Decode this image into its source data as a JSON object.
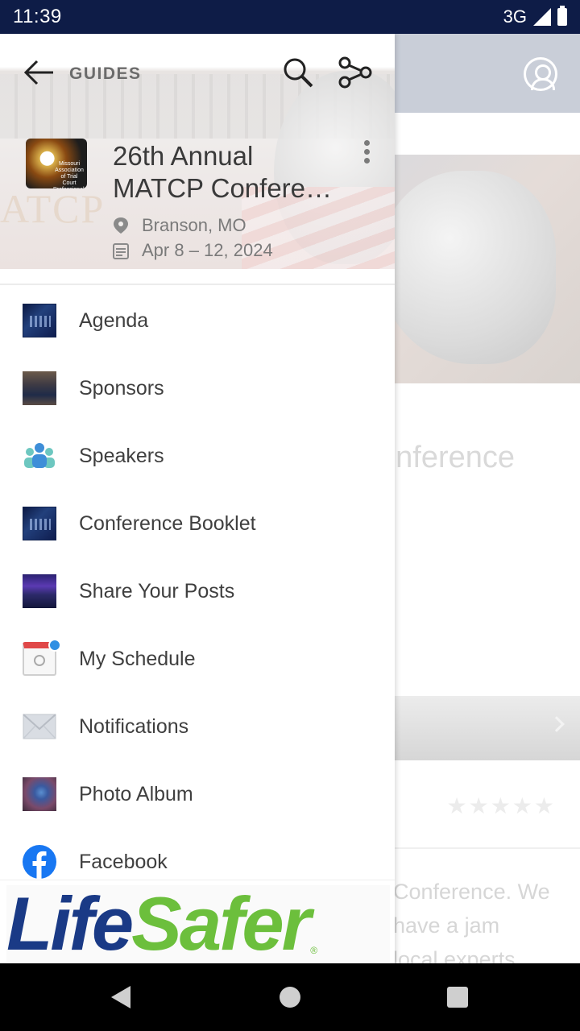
{
  "status_bar": {
    "time": "11:39",
    "network": "3G"
  },
  "background": {
    "title_fragment": "onference",
    "stars": "★★★★★",
    "text_lines": [
      "Conference. We",
      "have a jam",
      "local experts"
    ]
  },
  "drawer": {
    "toolbar": {
      "label": "GUIDES"
    },
    "event": {
      "title_line1": "26th Annual",
      "title_line2": "MATCP Confere…",
      "location": "Branson, MO",
      "dates": "Apr 8 – 12, 2024",
      "logo_text": "Missouri Association of Trial Court Professionals",
      "seal_text": "ATCP"
    },
    "menu_items": [
      {
        "label": "Agenda",
        "icon": "agenda-thumbnail"
      },
      {
        "label": "Sponsors",
        "icon": "sponsors-thumbnail"
      },
      {
        "label": "Speakers",
        "icon": "people-icon"
      },
      {
        "label": "Conference Booklet",
        "icon": "booklet-thumbnail"
      },
      {
        "label": "Share Your Posts",
        "icon": "posts-thumbnail"
      },
      {
        "label": "My Schedule",
        "icon": "calendar-icon"
      },
      {
        "label": "Notifications",
        "icon": "envelope-icon"
      },
      {
        "label": "Photo Album",
        "icon": "album-thumbnail"
      },
      {
        "label": "Facebook",
        "icon": "facebook-icon"
      }
    ],
    "sponsor": {
      "part1": "Life",
      "part2": "Safer",
      "reg": "®"
    }
  },
  "colors": {
    "status_bar": "#0e1c47",
    "sponsor_blue": "#1a3a86",
    "sponsor_green": "#6cbf3c",
    "facebook_blue": "#1877f2"
  }
}
